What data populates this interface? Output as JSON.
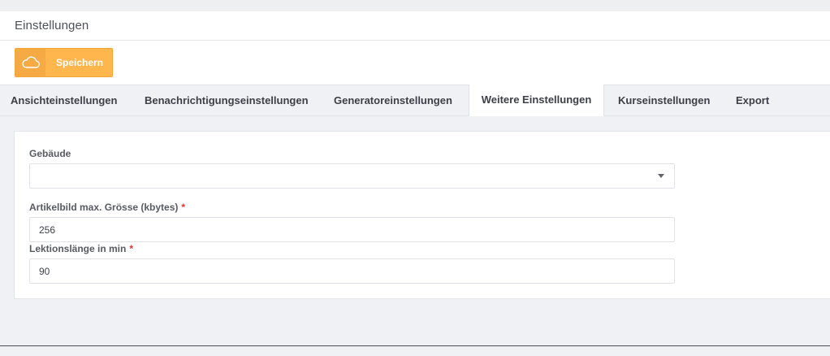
{
  "header": {
    "title": "Einstellungen"
  },
  "toolbar": {
    "save_label": "Speichern",
    "save_icon": "cloud-icon",
    "accent": "#ffb64d"
  },
  "tabs": [
    {
      "label": "Ansichteinstellungen",
      "active": false
    },
    {
      "label": "Benachrichtigungseinstellungen",
      "active": false
    },
    {
      "label": "Generatoreinstellungen",
      "active": false
    },
    {
      "label": "Weitere Einstellungen",
      "active": true
    },
    {
      "label": "Kurseinstellungen",
      "active": false
    },
    {
      "label": "Export",
      "active": false
    }
  ],
  "form": {
    "building": {
      "label": "Gebäude",
      "value": ""
    },
    "image_size": {
      "label": "Artikelbild max. Grösse (kbytes)",
      "required_mark": "*",
      "value": "256"
    },
    "lesson_length": {
      "label": "Lektionslänge in min",
      "required_mark": "*",
      "value": "90"
    }
  }
}
